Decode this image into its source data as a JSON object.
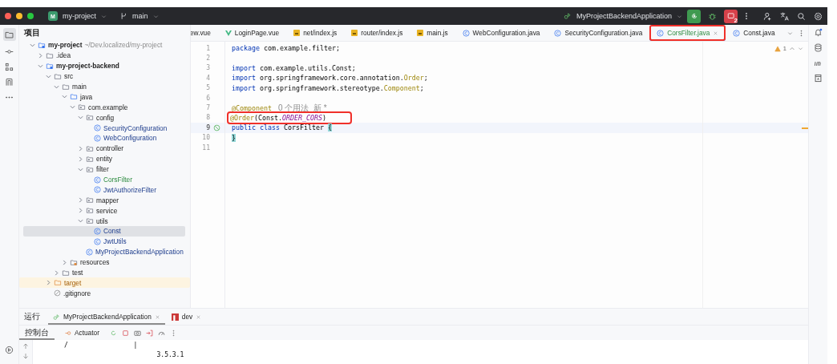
{
  "title_bar": {
    "project_badge": "M",
    "project": "my-project",
    "branch": "main",
    "run_config": "MyProjectBackendApplication",
    "stop_badge": "2"
  },
  "project_panel": {
    "title": "项目",
    "tree": [
      {
        "label": "my-project",
        "hint": "~/Dev.localized/my-project",
        "kind": "module",
        "expanded": true,
        "selected": false,
        "children": [
          {
            "label": ".idea",
            "kind": "folder",
            "expanded": false,
            "selected": false
          },
          {
            "label": "my-project-backend",
            "kind": "module",
            "expanded": true,
            "selected": false,
            "children": [
              {
                "label": "src",
                "kind": "folder",
                "expanded": true,
                "selected": false,
                "children": [
                  {
                    "label": "main",
                    "kind": "folder",
                    "expanded": true,
                    "selected": false,
                    "children": [
                      {
                        "label": "java",
                        "kind": "source",
                        "expanded": true,
                        "selected": false,
                        "children": [
                          {
                            "label": "com.example",
                            "kind": "package",
                            "expanded": true,
                            "selected": false,
                            "children": [
                              {
                                "label": "config",
                                "kind": "package",
                                "expanded": true,
                                "selected": false,
                                "children": [
                                  {
                                    "label": "SecurityConfiguration",
                                    "kind": "class",
                                    "selected": false
                                  },
                                  {
                                    "label": "WebConfiguration",
                                    "kind": "class",
                                    "selected": false
                                  }
                                ]
                              },
                              {
                                "label": "controller",
                                "kind": "package",
                                "expanded": false,
                                "selected": false
                              },
                              {
                                "label": "entity",
                                "kind": "package",
                                "expanded": false,
                                "selected": false
                              },
                              {
                                "label": "filter",
                                "kind": "package",
                                "expanded": true,
                                "selected": false,
                                "children": [
                                  {
                                    "label": "CorsFilter",
                                    "kind": "class",
                                    "added": true,
                                    "selected": false
                                  },
                                  {
                                    "label": "JwtAuthorizeFilter",
                                    "kind": "class",
                                    "selected": false
                                  }
                                ]
                              },
                              {
                                "label": "mapper",
                                "kind": "package",
                                "expanded": false,
                                "selected": false
                              },
                              {
                                "label": "service",
                                "kind": "package",
                                "expanded": false,
                                "selected": false
                              },
                              {
                                "label": "utils",
                                "kind": "package",
                                "expanded": true,
                                "selected": false,
                                "children": [
                                  {
                                    "label": "Const",
                                    "kind": "class",
                                    "selected": true
                                  },
                                  {
                                    "label": "JwtUtils",
                                    "kind": "class",
                                    "selected": false
                                  }
                                ]
                              },
                              {
                                "label": "MyProjectBackendApplication",
                                "kind": "app",
                                "selected": false
                              }
                            ]
                          }
                        ]
                      },
                      {
                        "label": "resources",
                        "kind": "resources",
                        "expanded": false,
                        "selected": false
                      }
                    ]
                  },
                  {
                    "label": "test",
                    "kind": "folder",
                    "expanded": false,
                    "selected": false
                  }
                ]
              },
              {
                "label": "target",
                "kind": "excluded",
                "expanded": false,
                "selected": false
              },
              {
                "label": ".gitignore",
                "kind": "ignore",
                "selected": false
              }
            ]
          }
        ]
      }
    ]
  },
  "editor_tabs": [
    {
      "label": "ew.vue",
      "kind": "none",
      "selected": false,
      "highlighted": false
    },
    {
      "label": "LoginPage.vue",
      "kind": "vue",
      "selected": false,
      "highlighted": false
    },
    {
      "label": "net/index.js",
      "kind": "js",
      "selected": false,
      "highlighted": false
    },
    {
      "label": "router/index.js",
      "kind": "js",
      "selected": false,
      "highlighted": false
    },
    {
      "label": "main.js",
      "kind": "js",
      "selected": false,
      "highlighted": false
    },
    {
      "label": "WebConfiguration.java",
      "kind": "class",
      "selected": false,
      "highlighted": false
    },
    {
      "label": "SecurityConfiguration.java",
      "kind": "class",
      "selected": false,
      "highlighted": false
    },
    {
      "label": "CorsFilter.java",
      "kind": "class",
      "selected": true,
      "highlighted": true
    },
    {
      "label": "Const.java",
      "kind": "class",
      "selected": false,
      "highlighted": false
    }
  ],
  "editor": {
    "warning_count": "1",
    "lines": [
      {
        "number": "1",
        "highlighted": false,
        "current": false,
        "tokens": [
          {
            "text": "package ",
            "kind": "keyword"
          },
          {
            "text": "com.example.filter;",
            "kind": "plain"
          }
        ]
      },
      {
        "number": "2",
        "current": false
      },
      {
        "number": "3",
        "highlighted": false,
        "current": false,
        "tokens": [
          {
            "text": "import ",
            "kind": "keyword"
          },
          {
            "text": "com.example.utils.Const;",
            "kind": "plain"
          }
        ]
      },
      {
        "number": "4",
        "highlighted": false,
        "current": false,
        "tokens": [
          {
            "text": "import ",
            "kind": "keyword"
          },
          {
            "text": "org.springframework.core.annotation.",
            "kind": "plain"
          },
          {
            "text": "Order",
            "kind": "annotation"
          },
          {
            "text": ";",
            "kind": "plain"
          }
        ]
      },
      {
        "number": "5",
        "highlighted": false,
        "current": false,
        "tokens": [
          {
            "text": "import ",
            "kind": "keyword"
          },
          {
            "text": "org.springframework.stereotype.",
            "kind": "plain"
          },
          {
            "text": "Component",
            "kind": "annotation"
          },
          {
            "text": ";",
            "kind": "plain"
          }
        ]
      },
      {
        "number": "6",
        "current": false
      },
      {
        "number": "7",
        "highlighted": false,
        "current": false,
        "tokens": [
          {
            "text": "@Component",
            "kind": "annotation"
          },
          {
            "text": "0 个用法  新 *",
            "kind": "hint"
          }
        ]
      },
      {
        "number": "8",
        "highlighted": true,
        "current": false,
        "tokens": [
          {
            "text": "@Order",
            "kind": "annotation"
          },
          {
            "text": "(Const.",
            "kind": "plain"
          },
          {
            "text": "ORDER_CORS",
            "kind": "constant"
          },
          {
            "text": ")",
            "kind": "plain"
          }
        ]
      },
      {
        "number": "9",
        "highlighted": false,
        "current": true,
        "gutter": true,
        "tokens": [
          {
            "text": "public class ",
            "kind": "keyword"
          },
          {
            "text": "CorsFilter ",
            "kind": "declaration"
          },
          {
            "text": "{",
            "kind": "brace"
          }
        ]
      },
      {
        "number": "10",
        "highlighted": false,
        "current": false,
        "tokens": [
          {
            "text": "}",
            "kind": "brace"
          }
        ]
      },
      {
        "number": "11",
        "current": false
      }
    ]
  },
  "run_panel": {
    "title": "运行",
    "tabs": [
      {
        "label": "MyProjectBackendApplication",
        "kind": "app",
        "selected": true
      },
      {
        "label": "dev",
        "kind": "npm",
        "selected": false
      }
    ],
    "toolbar": [
      {
        "label": "控制台",
        "selected": true
      },
      {
        "label": "Actuator",
        "selected": false
      }
    ],
    "console": [
      "      /                 |",
      "                              3.5.3.1"
    ]
  }
}
